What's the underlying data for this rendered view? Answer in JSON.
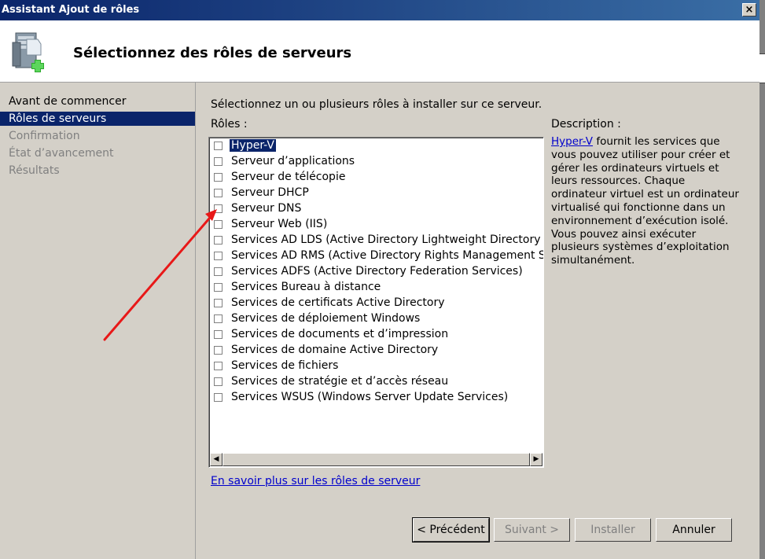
{
  "window": {
    "title": "Assistant Ajout de rôles",
    "close_glyph": "×"
  },
  "header": {
    "heading": "Sélectionnez des rôles de serveurs",
    "icon": "server-add-icon"
  },
  "sidebar": {
    "items": [
      {
        "label": "Avant de commencer",
        "state": "normal"
      },
      {
        "label": "Rôles de serveurs",
        "state": "selected"
      },
      {
        "label": "Confirmation",
        "state": "disabled"
      },
      {
        "label": "État d’avancement",
        "state": "disabled"
      },
      {
        "label": "Résultats",
        "state": "disabled"
      }
    ]
  },
  "main": {
    "instruction": "Sélectionnez un ou plusieurs rôles à installer sur ce serveur.",
    "roles_label": "Rôles :",
    "roles": [
      {
        "label": "Hyper-V",
        "checked": false,
        "selected": true
      },
      {
        "label": "Serveur d’applications",
        "checked": false
      },
      {
        "label": "Serveur de télécopie",
        "checked": false
      },
      {
        "label": "Serveur DHCP",
        "checked": false
      },
      {
        "label": "Serveur DNS",
        "checked": false
      },
      {
        "label": "Serveur Web (IIS)",
        "checked": false
      },
      {
        "label": "Services AD LDS (Active Directory Lightweight Directory Services)",
        "checked": false
      },
      {
        "label": "Services AD RMS (Active Directory Rights Management Services)",
        "checked": false
      },
      {
        "label": "Services ADFS (Active Directory Federation Services)",
        "checked": false
      },
      {
        "label": "Services Bureau à distance",
        "checked": false
      },
      {
        "label": "Services de certificats Active Directory",
        "checked": false
      },
      {
        "label": "Services de déploiement Windows",
        "checked": false
      },
      {
        "label": "Services de documents et d’impression",
        "checked": false
      },
      {
        "label": "Services de domaine Active Directory",
        "checked": false
      },
      {
        "label": "Services de fichiers",
        "checked": false
      },
      {
        "label": "Services de stratégie et d’accès réseau",
        "checked": false
      },
      {
        "label": "Services WSUS (Windows Server Update Services)",
        "checked": false
      }
    ],
    "scroll_left": "◀",
    "scroll_right": "▶",
    "description": {
      "title": "Description :",
      "link": "Hyper-V",
      "text": " fournit les services que vous pouvez utiliser pour créer et gérer les ordinateurs virtuels et leurs ressources. Chaque ordinateur virtuel est un ordinateur virtualisé qui fonctionne dans un environnement d’exécution isolé. Vous pouvez ainsi exécuter plusieurs systèmes d’exploitation simultanément."
    },
    "learn_more": "En savoir plus sur les rôles de serveur"
  },
  "buttons": {
    "previous": "< Précédent",
    "next": "Suivant >",
    "install": "Installer",
    "cancel": "Annuler"
  },
  "colors": {
    "selection": "#0a246a",
    "annotation_arrow": "#e81818",
    "link": "#0000cc"
  }
}
